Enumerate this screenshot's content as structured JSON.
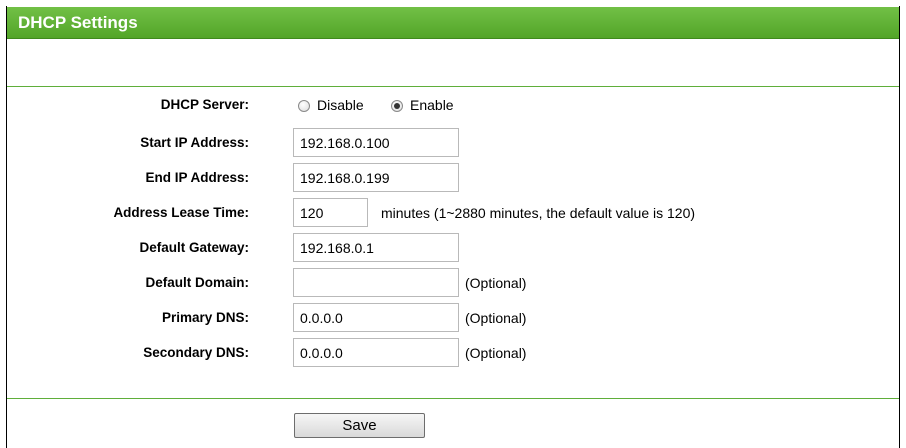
{
  "header": {
    "title": "DHCP Settings"
  },
  "form": {
    "dhcp_server": {
      "label": "DHCP Server:",
      "options": [
        {
          "label": "Disable",
          "selected": false
        },
        {
          "label": "Enable",
          "selected": true
        }
      ]
    },
    "start_ip": {
      "label": "Start IP Address:",
      "value": "192.168.0.100"
    },
    "end_ip": {
      "label": "End IP Address:",
      "value": "192.168.0.199"
    },
    "lease_time": {
      "label": "Address Lease Time:",
      "value": "120",
      "hint": "minutes (1~2880 minutes, the default value is 120)"
    },
    "default_gateway": {
      "label": "Default Gateway:",
      "value": "192.168.0.1"
    },
    "default_domain": {
      "label": "Default Domain:",
      "value": "",
      "note": "(Optional)"
    },
    "primary_dns": {
      "label": "Primary DNS:",
      "value": "0.0.0.0",
      "note": "(Optional)"
    },
    "secondary_dns": {
      "label": "Secondary DNS:",
      "value": "0.0.0.0",
      "note": "(Optional)"
    }
  },
  "actions": {
    "save_label": "Save"
  },
  "colors": {
    "header_green": "#5fb433",
    "divider_green": "#5fae3a"
  }
}
